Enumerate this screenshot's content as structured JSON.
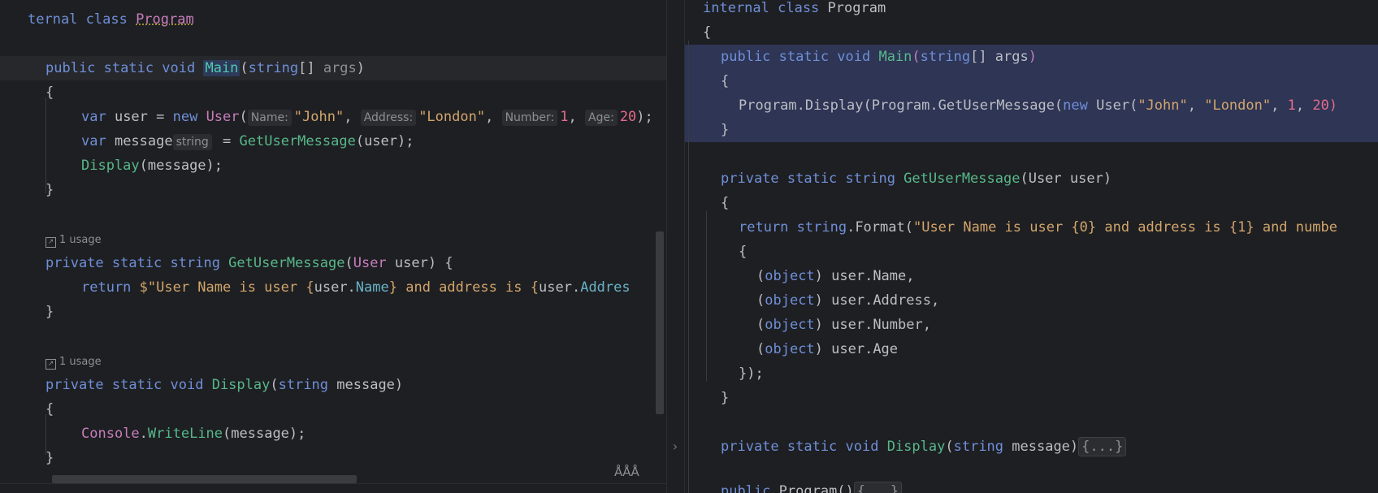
{
  "left": {
    "l1": {
      "kw": "ternal class ",
      "cls": "Program"
    },
    "l2": {
      "kw": "public static void ",
      "fn": "Main",
      "p1": "(",
      "t": "string",
      "p2": "[] ",
      "arg": "args",
      "p3": ")"
    },
    "l3": "{",
    "l4": {
      "kw": "var ",
      "a": "user = ",
      "kw2": "new ",
      "cls": "User",
      "p": "(",
      "h1": "Name:",
      "s1": "\"John\"",
      "c1": ", ",
      "h2": "Address:",
      "s2": "\"London\"",
      "c2": ", ",
      "h3": "Number:",
      "n1": "1",
      "c3": ", ",
      "h4": "Age:",
      "n2": "20",
      "end": ");"
    },
    "l5": {
      "kw": "var ",
      "a": "message",
      "hint": "string",
      "b": " = ",
      "fn": "GetUserMessage",
      "c": "(user);"
    },
    "l6": {
      "fn": "Display",
      "c": "(message);"
    },
    "l7": "}",
    "usage1": "1 usage",
    "l8": {
      "kw": "private static string ",
      "fn": "GetUserMessage",
      "p": "(",
      "cls": "User",
      "rest": " user) {"
    },
    "l9": {
      "kw": "return ",
      "s1": "$\"User Name is user ",
      "b1": "{",
      "v1": "user.",
      "f1": "Name",
      "b2": "}",
      "s2": " and address is ",
      "b3": "{",
      "v2": "user.",
      "f2": "Addres"
    },
    "l10": "}",
    "usage2": "1 usage",
    "l11": {
      "kw": "private static void ",
      "fn": "Display",
      "p": "(",
      "t": "string",
      "rest": " message)"
    },
    "l12": "{",
    "l13": {
      "cls": "Console",
      "dot": ".",
      "fn": "WriteLine",
      "rest": "(message);"
    },
    "l14": "}",
    "reader": "ÅÅÅ"
  },
  "right": {
    "r1": {
      "kw": "internal class ",
      "name": "Program"
    },
    "r2": "{",
    "r3": {
      "kw": "public static void ",
      "fn": "Main",
      "p": "(",
      "t": "string",
      "rest": "[] args",
      "p2": ")"
    },
    "r4": "{",
    "r5": {
      "a": "Program.Display(Program.GetUserMessage(",
      "kw": "new ",
      "b": "User(",
      "s1": "\"John\"",
      "c1": ", ",
      "s2": "\"London\"",
      "c2": ", ",
      "n1": "1",
      "c3": ", ",
      "n2": "20)"
    },
    "r6": "}",
    "r7": {
      "kw": "private static string ",
      "fn": "GetUserMessage",
      "rest": "(User user)"
    },
    "r8": "{",
    "r9": {
      "kw": "return ",
      "t": "string",
      "a": ".Format(",
      "s": "\"User Name is user {0} and address is {1} and numbe"
    },
    "r10": "{",
    "r11": {
      "p": "(",
      "kw": "object",
      "rest": ") user.Name,"
    },
    "r12": {
      "p": "(",
      "kw": "object",
      "rest": ") user.Address,"
    },
    "r13": {
      "p": "(",
      "kw": "object",
      "rest": ") user.Number,"
    },
    "r14": {
      "p": "(",
      "kw": "object",
      "rest": ") user.Age"
    },
    "r15": "});",
    "r16": "}",
    "r17": {
      "kw": "private static void ",
      "fn": "Display",
      "p": "(",
      "t": "string",
      "rest": " message)",
      "fold": "{...}"
    },
    "r18": {
      "kw": "public ",
      "rest": "Program()",
      "fold": "{...}"
    }
  },
  "divider_arrow": "›"
}
